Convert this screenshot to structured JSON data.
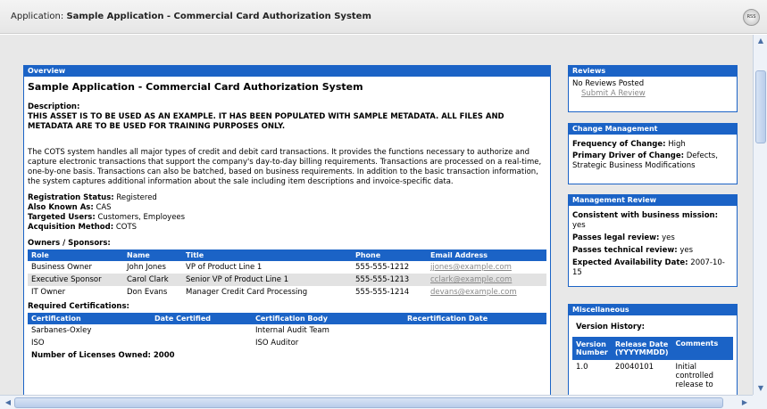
{
  "window": {
    "prefix": "Application:",
    "title": "Sample Application - Commercial Card Authorization System",
    "rss_label": "RSS"
  },
  "overview": {
    "header": "Overview",
    "title": "Sample Application - Commercial Card Authorization System",
    "description_label": "Description:",
    "notice": "THIS ASSET IS TO BE USED AS AN EXAMPLE. IT HAS BEEN POPULATED WITH SAMPLE METADATA. ALL FILES AND METADATA ARE TO BE USED FOR TRAINING PURPOSES ONLY.",
    "paragraph": "The COTS system handles all major types of credit and debit card transactions. It provides the functions necessary to authorize and capture electronic transactions that support the company's day-to-day billing requirements. Transactions are processed on a real-time, one-by-one basis. Transactions can also be batched, based on business requirements. In addition to the basic transaction information, the system captures additional information about the sale including item descriptions and invoice-specific data.",
    "registration_label": "Registration Status:",
    "registration_value": "Registered",
    "aka_label": "Also Known As:",
    "aka_value": "CAS",
    "users_label": "Targeted Users:",
    "users_value": "Customers, Employees",
    "acq_label": "Acquisition Method:",
    "acq_value": "COTS",
    "owners_label": "Owners / Sponsors:",
    "owners_columns": [
      "Role",
      "Name",
      "Title",
      "Phone",
      "Email Address"
    ],
    "owners_rows": [
      [
        "Business Owner",
        "John Jones",
        "VP of Product Line 1",
        "555-555-1212",
        "jjones@example.com"
      ],
      [
        "Executive Sponsor",
        "Carol Clark",
        "Senior VP of Product Line 1",
        "555-555-1213",
        "cclark@example.com"
      ],
      [
        "IT Owner",
        "Don Evans",
        "Manager Credit Card Processing",
        "555-555-1214",
        "devans@example.com"
      ]
    ],
    "cert_label": "Required Certifications:",
    "cert_columns": [
      "Certification",
      "Date Certified",
      "Certification Body",
      "Recertification Date"
    ],
    "cert_rows": [
      [
        "Sarbanes-Oxley",
        "",
        "Internal Audit Team",
        ""
      ],
      [
        "ISO",
        "",
        "ISO Auditor",
        ""
      ]
    ],
    "cutoff_text": "Number of Licenses Owned: 2000"
  },
  "reviews": {
    "header": "Reviews",
    "text": "No Reviews Posted",
    "link": "Submit A Review"
  },
  "change": {
    "header": "Change Management",
    "freq_label": "Frequency of Change:",
    "freq_value": "High",
    "driver_label": "Primary Driver of Change:",
    "driver_value": "Defects, Strategic Business Modifications"
  },
  "mgmt": {
    "header": "Management Review",
    "mission_label": "Consistent with business mission:",
    "mission_value": "yes",
    "legal_label": "Passes legal review:",
    "legal_value": "yes",
    "tech_label": "Passes technical review:",
    "tech_value": "yes",
    "avail_label": "Expected Availability Date:",
    "avail_value": "2007-10-15"
  },
  "misc": {
    "header": "Miscellaneous",
    "version_label": "Version History:",
    "columns": [
      "Version Number",
      "Release Date (YYYYMMDD)",
      "Comments"
    ],
    "rows": [
      [
        "1.0",
        "20040101",
        "Initial controlled release to"
      ]
    ]
  }
}
